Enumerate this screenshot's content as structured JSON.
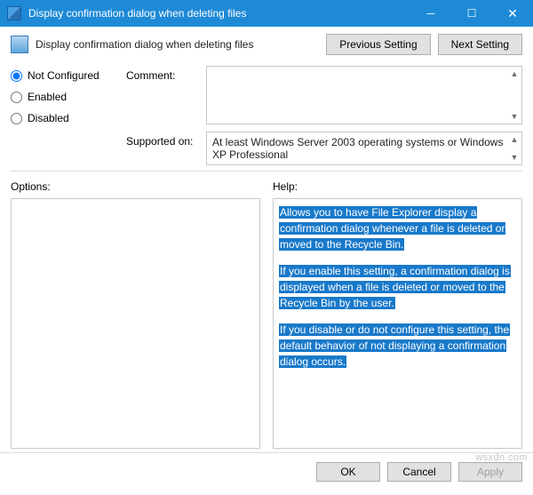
{
  "titlebar": {
    "title": "Display confirmation dialog when deleting files"
  },
  "header": {
    "policy_title": "Display confirmation dialog when deleting files",
    "prev_label": "Previous Setting",
    "next_label": "Next Setting"
  },
  "radios": {
    "not_configured": "Not Configured",
    "enabled": "Enabled",
    "disabled": "Disabled",
    "selected": "not_configured"
  },
  "labels": {
    "comment": "Comment:",
    "supported_on": "Supported on:",
    "options": "Options:",
    "help": "Help:"
  },
  "fields": {
    "comment_value": "",
    "supported_value": "At least Windows Server 2003 operating systems or Windows XP Professional"
  },
  "help": {
    "p1": "Allows you to have File Explorer display a confirmation dialog whenever a file is deleted or moved to the Recycle Bin.",
    "p2": "If you enable this setting, a confirmation dialog is displayed when a file is deleted or moved to the Recycle Bin by the user.",
    "p3": "If you disable or do not configure this setting, the default behavior of not displaying a confirmation dialog occurs."
  },
  "footer": {
    "ok": "OK",
    "cancel": "Cancel",
    "apply": "Apply"
  },
  "watermark": "wsxdn.com"
}
